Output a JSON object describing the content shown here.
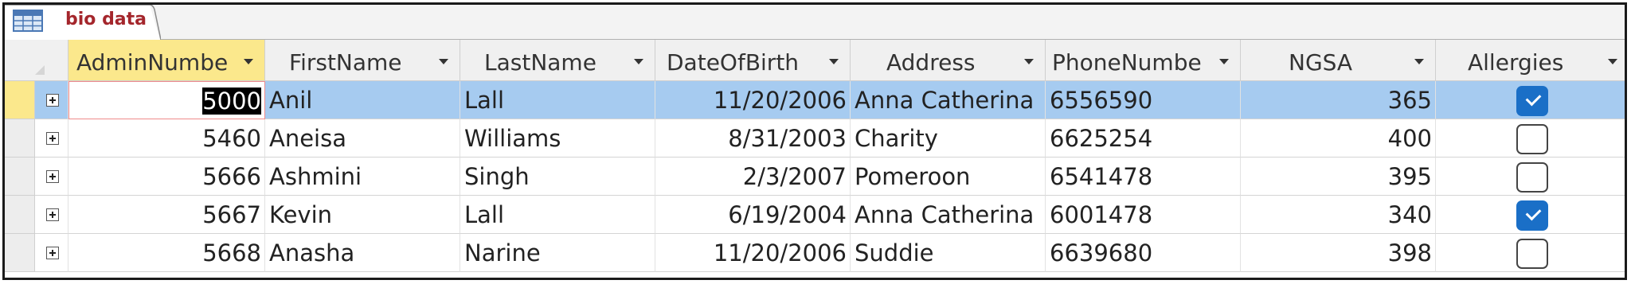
{
  "tab": {
    "label": "bio data",
    "icon": "table-icon"
  },
  "columns": [
    "AdminNumbe",
    "FirstName",
    "LastName",
    "DateOfBirth",
    "Address",
    "PhoneNumbe",
    "NGSA",
    "Allergies"
  ],
  "rows": [
    {
      "admin": "5000",
      "first": "Anil",
      "last": "Lall",
      "dob": "11/20/2006",
      "address": "Anna Catherina",
      "phone": "6556590",
      "ngsa": "365",
      "allergies": true
    },
    {
      "admin": "5460",
      "first": "Aneisa",
      "last": "Williams",
      "dob": "8/31/2003",
      "address": "Charity",
      "phone": "6625254",
      "ngsa": "400",
      "allergies": false
    },
    {
      "admin": "5666",
      "first": "Ashmini",
      "last": "Singh",
      "dob": "2/3/2007",
      "address": "Pomeroon",
      "phone": "6541478",
      "ngsa": "395",
      "allergies": false
    },
    {
      "admin": "5667",
      "first": "Kevin",
      "last": "Lall",
      "dob": "6/19/2004",
      "address": "Anna Catherina",
      "phone": "6001478",
      "ngsa": "340",
      "allergies": true
    },
    {
      "admin": "5668",
      "first": "Anasha",
      "last": "Narine",
      "dob": "11/20/2006",
      "address": "Suddie",
      "phone": "6639680",
      "ngsa": "398",
      "allergies": false
    }
  ],
  "colors": {
    "selected_row": "#a6cbf0",
    "active_header": "#fbe88c",
    "tab_text": "#a4262c",
    "checkbox_on": "#1a6fc7"
  }
}
